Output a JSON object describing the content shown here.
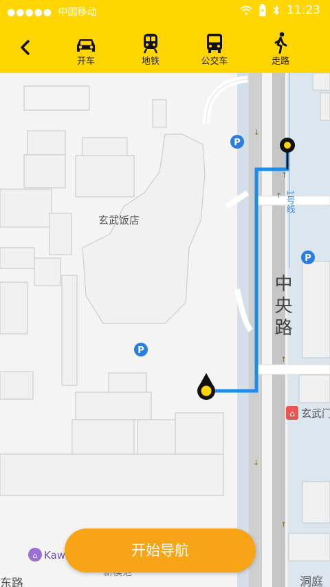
{
  "status_bar": {
    "signal": "●●●●●",
    "carrier": "中国移动",
    "time": "11:23"
  },
  "nav": {
    "modes": [
      {
        "label": "开车",
        "icon": "car-icon"
      },
      {
        "label": "地铁",
        "icon": "subway-icon"
      },
      {
        "label": "公交车",
        "icon": "bus-icon"
      },
      {
        "label": "走路",
        "icon": "walk-icon"
      }
    ]
  },
  "map": {
    "hotel_label": "玄武饭店",
    "road_label": "中央路",
    "metro_label": "1号线",
    "station_label": "玄武门",
    "kawa_label": "Kaw",
    "bottom_left_label": "东路",
    "bottom_right_label": "洞庭",
    "bottom_center_label": "新模范",
    "parking": [
      "P",
      "P",
      "P"
    ]
  },
  "actions": {
    "start_navigation": "开始导航"
  },
  "colors": {
    "accent": "#ffd600",
    "route": "#1a8ef0",
    "button": "#f7a416"
  }
}
